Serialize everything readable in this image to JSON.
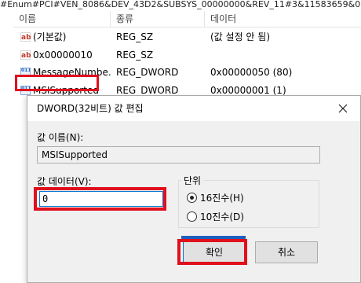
{
  "registry": {
    "path": "#Enum#PCI#VEN_8086&DEV_43D2&SUBSYS_00000000&REV_11#3&11583659&0",
    "columns": {
      "name": "이름",
      "type": "종류",
      "data": "데이터"
    },
    "rows": [
      {
        "icon": "ab",
        "name": "(기본값)",
        "type": "REG_SZ",
        "data": "(값 설정 안 됨)"
      },
      {
        "icon": "ab",
        "name": "0x00000010",
        "type": "REG_SZ",
        "data": ""
      },
      {
        "icon": "bin",
        "name": "MessageNumbe...",
        "type": "REG_DWORD",
        "data": "0x00000050 (80)"
      },
      {
        "icon": "bin",
        "name": "MSISupported",
        "type": "REG_DWORD",
        "data": "0x00000001 (1)"
      }
    ],
    "icon_glyphs": {
      "ab": "ab",
      "bin": "011 110"
    }
  },
  "dialog": {
    "title": "DWORD(32비트) 값 편집",
    "value_name_label": "값 이름(N):",
    "value_name": "MSISupported",
    "value_data_label": "값 데이터(V):",
    "value_data": "0",
    "base_label": "단위",
    "base_options": [
      {
        "label": "16진수(H)",
        "selected": true
      },
      {
        "label": "10진수(D)",
        "selected": false
      }
    ],
    "ok_label": "확인",
    "cancel_label": "취소"
  },
  "colors": {
    "highlight": "#e0101d",
    "focus": "#0078d7",
    "dialog_bg": "#f0f0f0"
  }
}
